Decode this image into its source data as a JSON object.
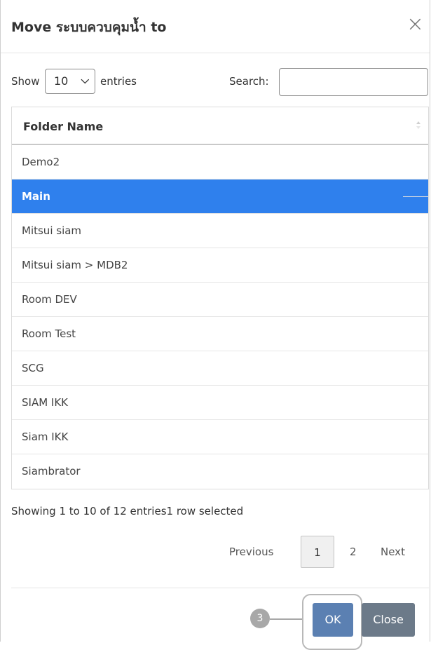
{
  "dialog": {
    "title": "Move ระบบควบคุมน้ำ to",
    "close_glyph": "×"
  },
  "controls": {
    "show_label": "Show",
    "entries_value": "10",
    "entries_label": "entries",
    "search_label": "Search:",
    "search_value": ""
  },
  "table": {
    "header": "Folder Name",
    "rows": [
      {
        "name": "Demo2",
        "selected": false
      },
      {
        "name": "Main",
        "selected": true
      },
      {
        "name": "Mitsui siam",
        "selected": false
      },
      {
        "name": "Mitsui siam > MDB2",
        "selected": false
      },
      {
        "name": "Room DEV",
        "selected": false
      },
      {
        "name": "Room Test",
        "selected": false
      },
      {
        "name": "SCG",
        "selected": false
      },
      {
        "name": "SIAM IKK",
        "selected": false
      },
      {
        "name": "Siam IKK",
        "selected": false
      },
      {
        "name": "Siambrator",
        "selected": false
      }
    ],
    "selected_color": "#2f80ed"
  },
  "info": "Showing 1 to 10 of 12 entries1 row selected",
  "pagination": {
    "previous": "Previous",
    "pages": [
      "1",
      "2"
    ],
    "current": "1",
    "next": "Next"
  },
  "buttons": {
    "ok": "OK",
    "close": "Close"
  },
  "annotation": {
    "step": "3"
  }
}
